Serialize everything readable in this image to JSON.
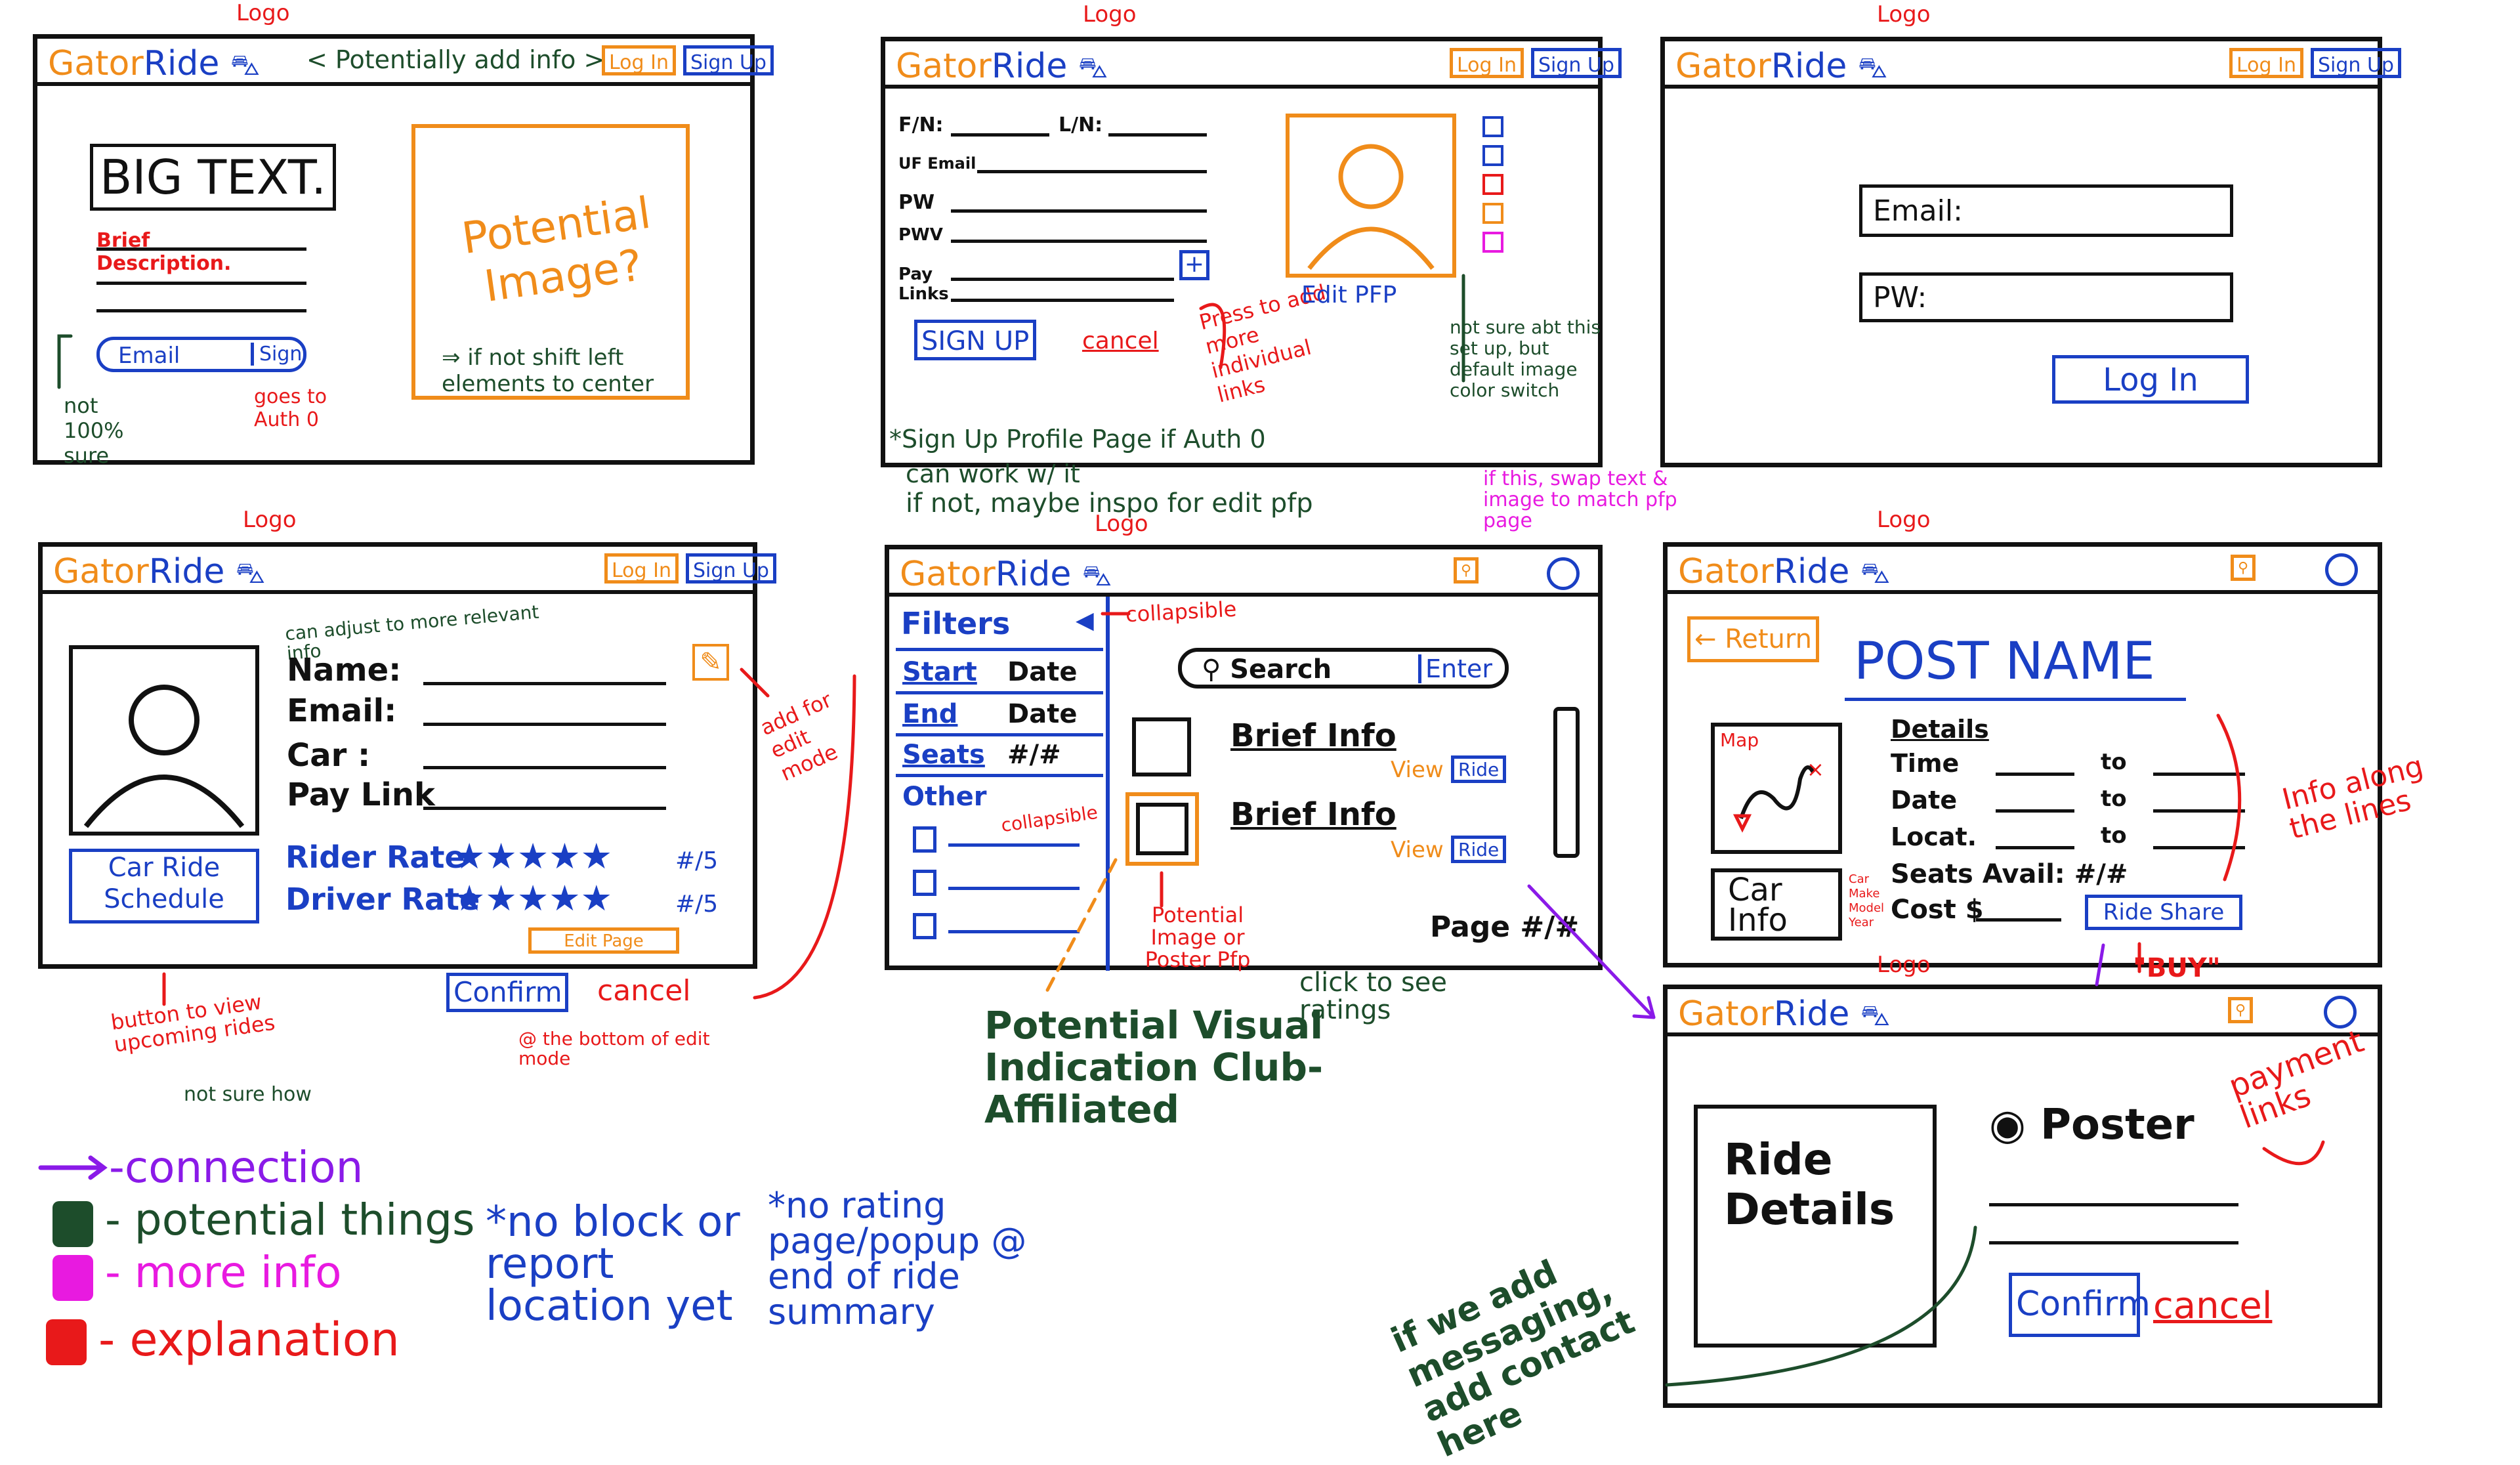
{
  "brand": {
    "name_part1": "Gator",
    "name_part2": "Ride"
  },
  "common": {
    "logo_tag": "Logo",
    "login": "Log In",
    "signup": "Sign Up",
    "search_btn": "Search"
  },
  "landing": {
    "add_info": "< Potentially add info >",
    "big_text": "BIG TEXT.",
    "brief_desc": "Brief Description.",
    "email_label": "Email",
    "sign_btn": "Sign",
    "potential_image": "Potential Image?",
    "shift_note": "⇒ if not shift left elements to center",
    "not_sure": "not 100% sure",
    "goes_to": "goes to Auth 0"
  },
  "signup_page": {
    "fn": "F/N:",
    "ln": "L/N:",
    "uf_email": "UF Email",
    "pw": "PW",
    "pwv": "PWV",
    "pay_links": "Pay Links",
    "signup_btn": "SIGN UP",
    "cancel_btn": "cancel",
    "press_note": "Press to add more individual links",
    "edit_pfp": "Edit PFP",
    "not_sure_note": "not sure abt this set up, but default image color switch",
    "caption": "*Sign Up Profile Page if Auth 0",
    "caption2": "can work w/ it",
    "caption3": "if not, maybe inspo for edit pfp",
    "swap_note": "if this, swap text & image to match pfp page"
  },
  "login_page": {
    "email": "Email:",
    "pw": "PW:",
    "login_btn": "Log In"
  },
  "profile_page": {
    "adjust_note": "can adjust to more relevant info",
    "name": "Name:",
    "email": "Email:",
    "car": "Car :",
    "pay_link": "Pay Link",
    "car_ride_schedule": "Car Ride Schedule",
    "rider_rate": "Rider Rate",
    "driver_rate": "Driver Rate",
    "rating_suffix": "#/5",
    "edit_page": "Edit Page",
    "add_edit_note": "add for edit mode",
    "confirm": "Confirm",
    "cancel": "cancel",
    "bottom_note": "@ the bottom of edit mode",
    "btn_note": "button to view upcoming rides",
    "not_sure_how": "not sure how"
  },
  "rides_page": {
    "filters": "Filters",
    "collapsible": "collapsible",
    "start_date_1": "Start",
    "start_date_2": "Date",
    "end_date_1": "End",
    "end_date_2": "Date",
    "seats": "Seats",
    "seats_val": "#/#",
    "other": "Other",
    "collapsible2": "collapsible",
    "search": "Search",
    "enter": "Enter",
    "brief_info": "Brief Info",
    "view": "View",
    "ride": "Ride",
    "page_num": "Page #/#",
    "potential_image": "Potential Image or Poster Pfp",
    "click_ratings": "click to see ratings",
    "club_note": "Potential Visual Indication Club-Affiliated"
  },
  "post_page": {
    "return": "Return",
    "post_name": "POST NAME",
    "map": "Map",
    "details": "Details",
    "time": "Time",
    "date": "Date",
    "locat": "Locat.",
    "to": "to",
    "seats_avail": "Seats Avail: #/#",
    "cost": "Cost $",
    "car_info": "Car Info",
    "car_make": "Car Make Model Year",
    "ride_share": "Ride Share",
    "buy": "\"BUY\"",
    "info_note": "Info along the lines"
  },
  "ride_detail_page": {
    "ride_details": "Ride Details",
    "poster": "Poster",
    "confirm": "Confirm",
    "cancel": "cancel",
    "payment_links": "payment links",
    "messaging_note": "if we add messaging, add contact here"
  },
  "legend": {
    "connection": "-connection",
    "potential": "- potential things",
    "more_info": "- more info",
    "explanation": "- explanation"
  },
  "notes": {
    "no_block": "*no block or report location yet",
    "no_rating": "*no rating page/popup @ end of ride summary"
  },
  "colors": {
    "orange": "#f08c1a",
    "blue": "#1a3fc4",
    "red": "#e8191a",
    "green": "#1d4d2b",
    "magenta": "#e81ae0",
    "purple": "#8a1ae8"
  }
}
